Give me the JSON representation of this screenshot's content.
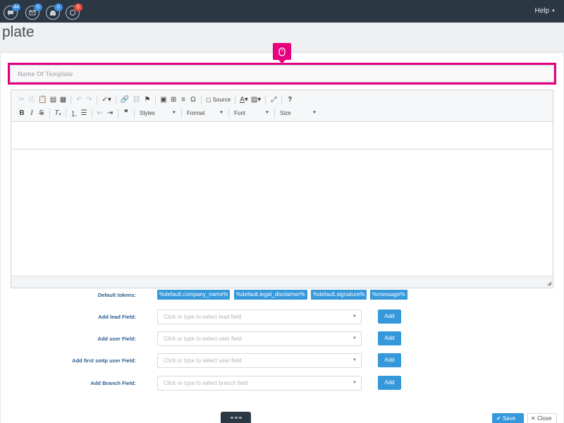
{
  "navbar": {
    "badges": {
      "chat": "44",
      "mail": "0",
      "inbox": "0",
      "messages": "0"
    },
    "help_label": "Help"
  },
  "page": {
    "title": "plate"
  },
  "form": {
    "name_placeholder": "Name Of Template"
  },
  "toolbar": {
    "source_label": "Source",
    "styles_label": "Styles",
    "format_label": "Format",
    "font_label": "Font",
    "size_label": "Size"
  },
  "tokens": {
    "label": "Default tokens:",
    "items": [
      "%default.company_name%",
      "%default.legal_disclaimer%",
      "%default.signature%",
      "%message%"
    ]
  },
  "fields": [
    {
      "label": "Add lead Field:",
      "placeholder": "Click or type to select lead field",
      "button": "Add"
    },
    {
      "label": "Add user Field:",
      "placeholder": "Click or type to select user field",
      "button": "Add"
    },
    {
      "label": "Add first smtp user Field:",
      "placeholder": "Click or type to select user field",
      "button": "Add"
    },
    {
      "label": "Add Branch Field:",
      "placeholder": "Click or type to select branch field",
      "button": "Add"
    }
  ],
  "footer": {
    "save_label": "Save",
    "close_label": "Close"
  },
  "colors": {
    "navbar": "#2c3744",
    "accent": "#3498db",
    "highlight": "#e6007e",
    "badge_red": "#e74c3c"
  }
}
